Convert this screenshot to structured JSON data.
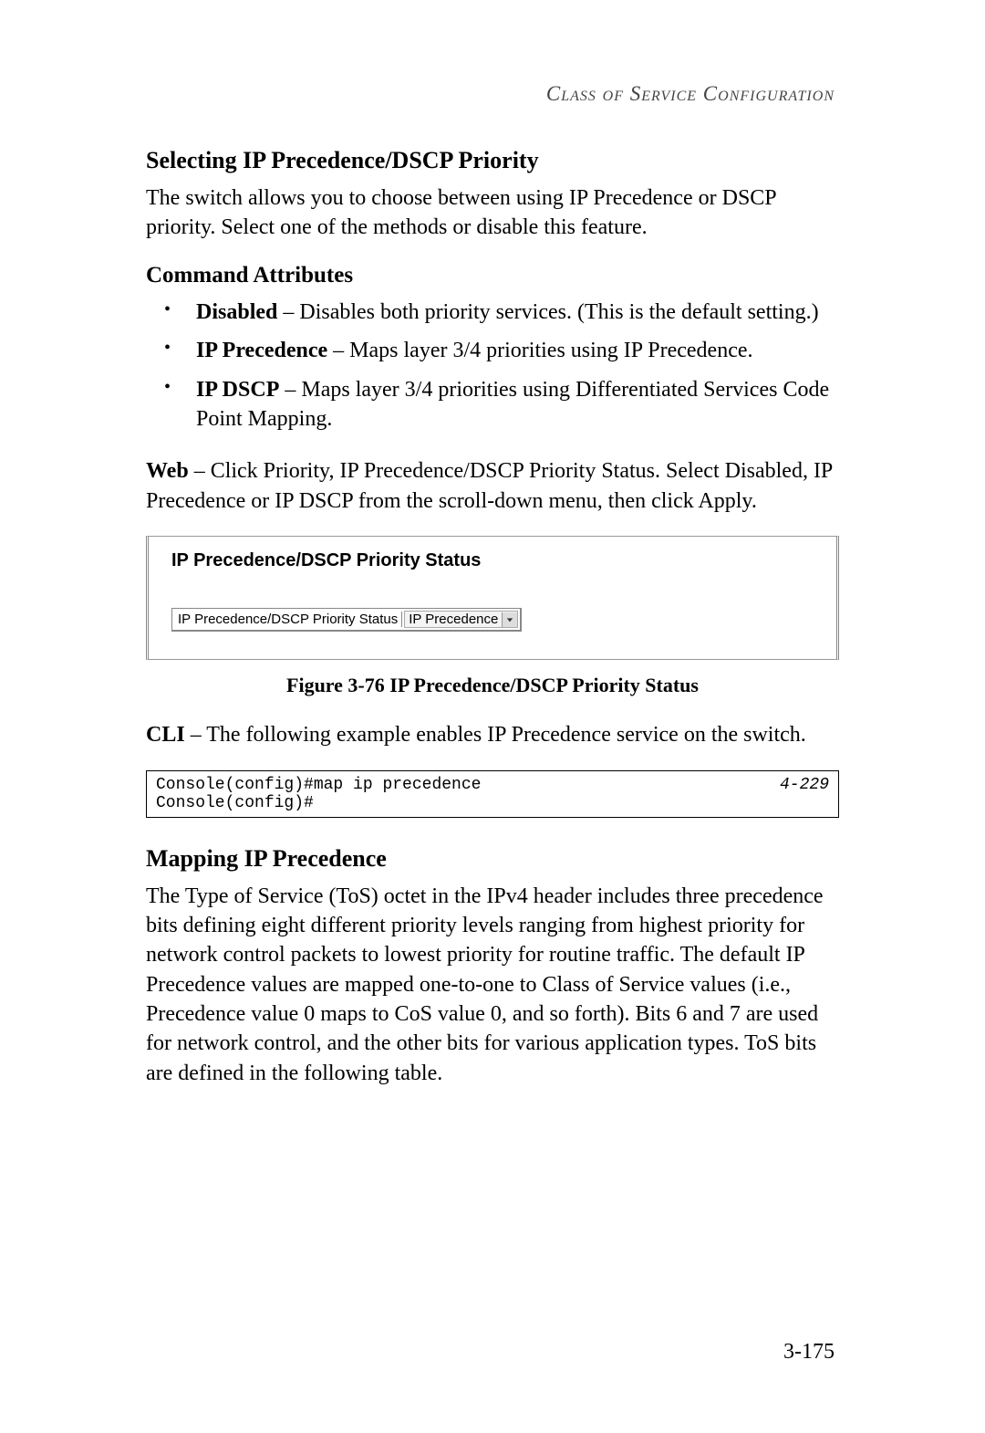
{
  "running_head": "Class of Service Configuration",
  "section1": {
    "title": "Selecting IP Precedence/DSCP Priority",
    "intro": "The switch allows you to choose between using IP Precedence or DSCP priority. Select one of the methods or disable this feature."
  },
  "attrs": {
    "heading": "Command Attributes",
    "items": [
      {
        "term": "Disabled",
        "desc": " – Disables both priority services. (This is the default setting.)"
      },
      {
        "term": "IP Precedence",
        "desc": " – Maps layer 3/4 priorities using IP Precedence."
      },
      {
        "term": "IP DSCP",
        "desc": " – Maps layer 3/4 priorities using Differentiated Services Code Point Mapping."
      }
    ]
  },
  "web": {
    "lead": "Web",
    "desc": " – Click Priority, IP Precedence/DSCP Priority Status. Select Disabled, IP Precedence or IP DSCP from the scroll-down menu, then click Apply."
  },
  "figure": {
    "panel_title": "IP Precedence/DSCP Priority Status",
    "form_label": "IP Precedence/DSCP Priority Status",
    "select_value": "IP Precedence",
    "caption": "Figure 3-76  IP Precedence/DSCP Priority Status"
  },
  "cli": {
    "lead": "CLI",
    "desc": " – The following example enables IP Precedence service on the switch.",
    "lines": "Console(config)#map ip precedence\nConsole(config)#",
    "ref": "4-229"
  },
  "section2": {
    "title": "Mapping IP Precedence",
    "body": "The Type of Service (ToS) octet in the IPv4 header includes three precedence bits defining eight different priority levels ranging from highest priority for network control packets to lowest priority for routine traffic. The default IP Precedence values are mapped one-to-one to Class of Service values (i.e., Precedence value 0 maps to CoS value 0, and so forth). Bits 6 and 7 are used for network control, and the other bits for various application types. ToS bits are defined in the following table."
  },
  "page_number": "3-175"
}
